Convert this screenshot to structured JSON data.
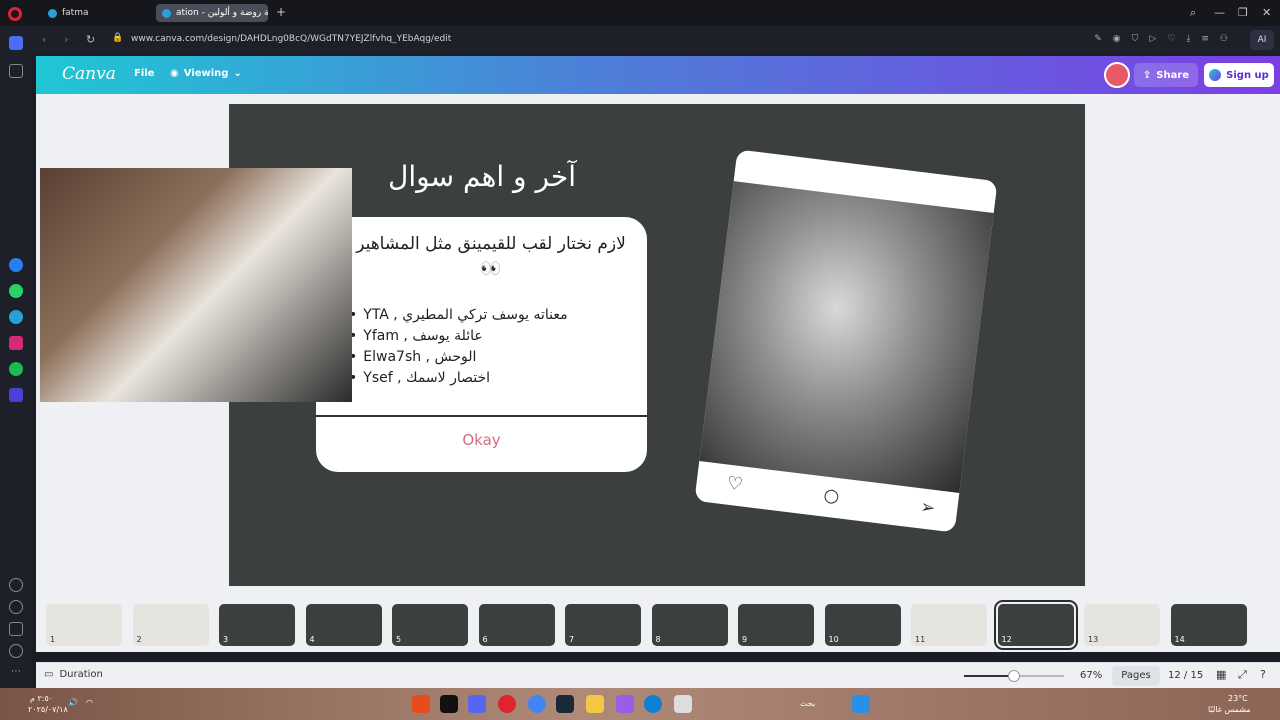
{
  "browser": {
    "tabs": [
      {
        "label": "fatma"
      },
      {
        "label": "ation - فعالية روضة و ألولين"
      }
    ],
    "url": "www.canva.com/design/DAHDLng0BcQ/WGdTN7YEJZlfvhq_YEbAqg/edit",
    "ai_label": "AI"
  },
  "canva": {
    "logo": "Canva",
    "menu_file": "File",
    "menu_viewing": "Viewing",
    "share_label": "Share",
    "signup_label": "Sign up"
  },
  "slide": {
    "title": "آخر و اهم سوال",
    "question": "لازم نختار لقب للقيمينق مثل المشاهير 👀",
    "bullets": [
      "YTA , معناته يوسف تركي المطيري",
      "Yfam , عائلة يوسف",
      "Elwa7sh , الوحش",
      "Ysef , اختصار لاسمك"
    ],
    "okay_label": "Okay",
    "insta_icons": [
      "heart-icon",
      "comment-icon",
      "send-icon"
    ]
  },
  "thumbnails": [
    {
      "num": "1",
      "theme": "light"
    },
    {
      "num": "2",
      "theme": "light"
    },
    {
      "num": "3",
      "theme": "dark"
    },
    {
      "num": "4",
      "theme": "dark"
    },
    {
      "num": "5",
      "theme": "dark"
    },
    {
      "num": "6",
      "theme": "dark"
    },
    {
      "num": "7",
      "theme": "dark"
    },
    {
      "num": "8",
      "theme": "dark"
    },
    {
      "num": "9",
      "theme": "dark"
    },
    {
      "num": "10",
      "theme": "dark"
    },
    {
      "num": "11",
      "theme": "light"
    },
    {
      "num": "12",
      "theme": "dark",
      "active": true
    },
    {
      "num": "13",
      "theme": "light"
    },
    {
      "num": "14",
      "theme": "dark"
    }
  ],
  "controls": {
    "duration_label": "Duration",
    "zoom": "67%",
    "zoom_fraction": 0.5,
    "pages_label": "Pages",
    "page_count": "12 / 15"
  },
  "taskbar": {
    "time": "٢:٥٠ م",
    "date": "٢٠٢٥/٠٧/١٨",
    "weather_temp": "23°C",
    "weather_desc": "مشمس غالبًا",
    "search_label": "بحث"
  },
  "colors": {
    "accent": "#7b3fe4",
    "okay": "#d96a7d",
    "slide_bg": "#3b3f3d"
  }
}
